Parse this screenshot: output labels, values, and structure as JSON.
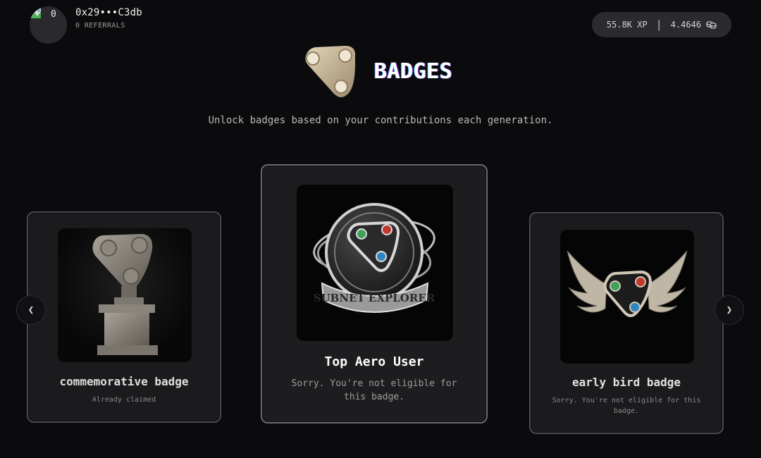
{
  "profile": {
    "count": "0",
    "address": "0x29•••C3db",
    "referrals": "0 REFERRALS"
  },
  "stats": {
    "xp": "55.8K XP",
    "separator": "|",
    "balance": "4.4646",
    "balance_icon": "coins-icon"
  },
  "page": {
    "title": "BADGES",
    "subtitle": "Unlock badges based on your contributions each generation."
  },
  "badges": [
    {
      "name": "commemorative badge",
      "status": "Already claimed",
      "icon": "trophy-badge-icon"
    },
    {
      "name": "Top Aero User",
      "status": "Sorry. You're not eligible for this badge.",
      "icon": "subnet-explorer-badge-icon",
      "banner": "SUBNET EXPLORER"
    },
    {
      "name": "early bird badge",
      "status": "Sorry. You're not eligible for this badge.",
      "icon": "winged-badge-icon"
    }
  ],
  "nav": {
    "prev": "❮",
    "next": "❯"
  },
  "colors": {
    "background": "#0b0b0d",
    "card": "#1b1b1e",
    "card_border": "#4a4a4f",
    "pill": "#2b2b2f",
    "badge_tan": "#c9b89c",
    "dot_green": "#4caf50",
    "dot_red": "#c0392b",
    "dot_blue": "#2e86c1"
  }
}
